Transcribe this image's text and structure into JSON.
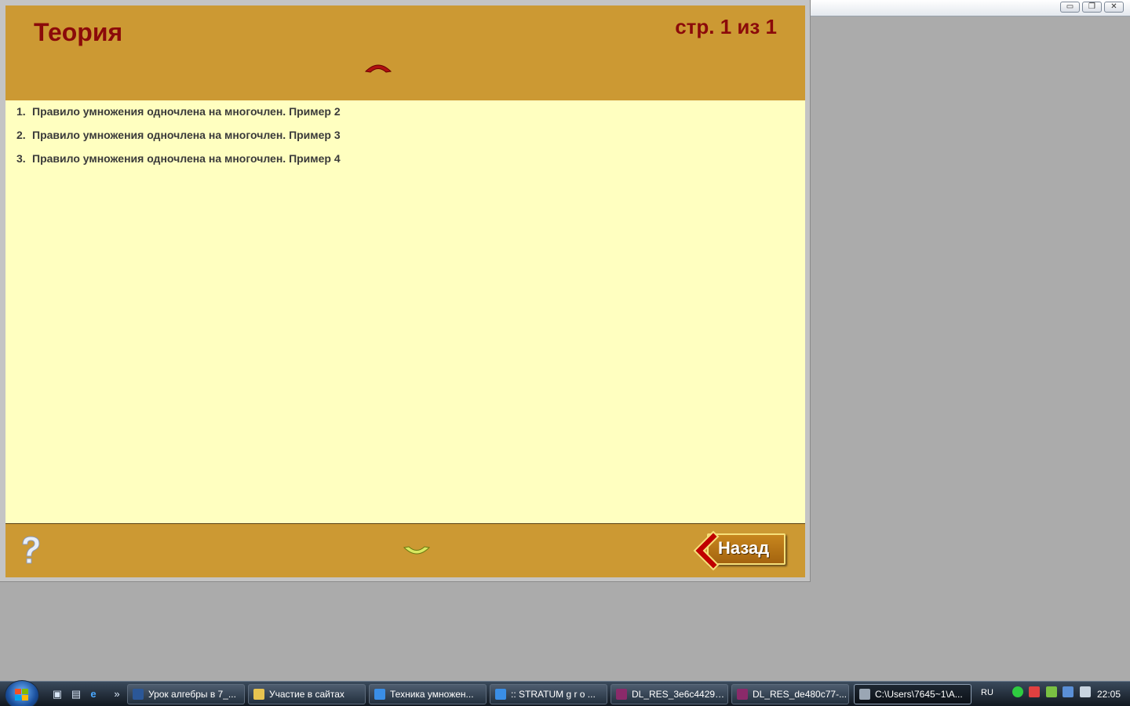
{
  "window": {
    "controls": {
      "minimize": "▭",
      "maximize": "❐",
      "close": "✕"
    }
  },
  "header": {
    "title": "Теория",
    "page_info": "стр. 1 из 1"
  },
  "content": {
    "items": [
      {
        "num": "1.",
        "text": "Правило умножения одночлена на многочлен. Пример 2"
      },
      {
        "num": "2.",
        "text": "Правило умножения одночлена на многочлен. Пример 3"
      },
      {
        "num": "3.",
        "text": "Правило умножения одночлена на многочлен. Пример 4"
      }
    ]
  },
  "footer": {
    "back_label": "Назад",
    "help_icon": "question-mark-icon"
  },
  "colors": {
    "header_bg": "#cc9933",
    "content_bg": "#ffffc0",
    "title_color": "#8b0a0a"
  },
  "taskbar": {
    "buttons": [
      {
        "label": "Урок алгебры в 7_...",
        "icon": "word-icon"
      },
      {
        "label": "Участие в сайтах",
        "icon": "folder-icon"
      },
      {
        "label": "Техника умножен...",
        "icon": "ie-icon"
      },
      {
        "label": ":: STRATUM g r o ...",
        "icon": "ie-icon"
      },
      {
        "label": "DL_RES_3e6c4429-8...",
        "icon": "winrar-icon"
      },
      {
        "label": "DL_RES_de480c77-...",
        "icon": "winrar-icon"
      },
      {
        "label": "C:\\Users\\7645~1\\A...",
        "icon": "app-icon"
      }
    ],
    "language": "RU",
    "clock": "22:05",
    "quicklaunch_more": "»"
  }
}
